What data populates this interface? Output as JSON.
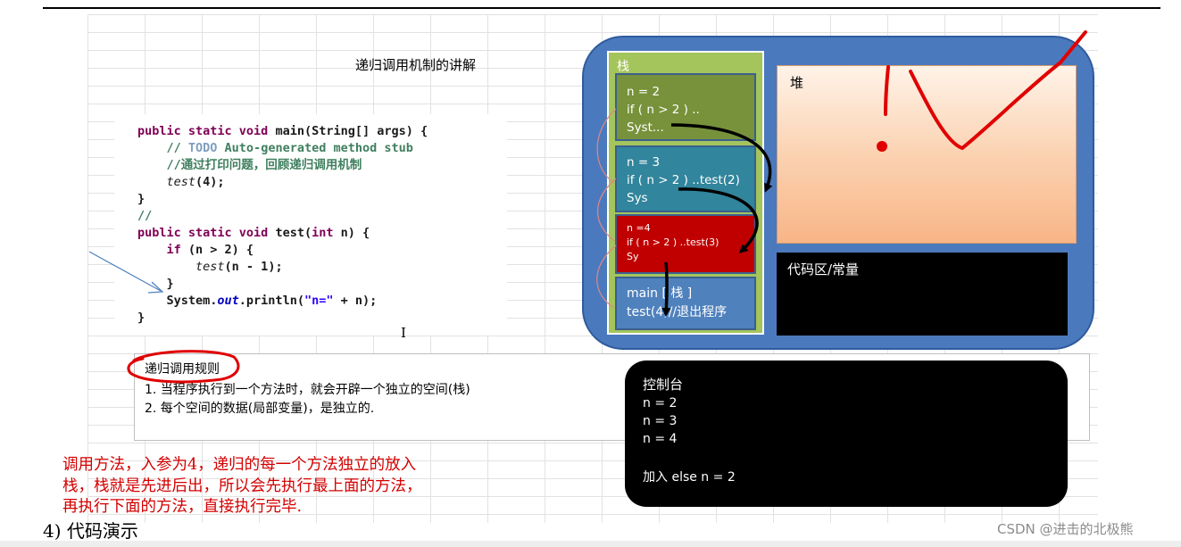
{
  "diagram_title": "递归调用机制的讲解",
  "code_lines": {
    "l1_kw": "public static void ",
    "l1_rest": "main(String[] args) {",
    "l2_indent": "    ",
    "l2_c1": "// ",
    "l2_todo": "TODO",
    "l2_c2": " Auto-generated method stub",
    "l3": "    //通过打印问题，回顾递归调用机制",
    "l4_indent": "    ",
    "l4_call": "test",
    "l4_rest": "(4);",
    "l5": "}",
    "l6": "//",
    "l7_kw": "public static void ",
    "l7_mid": "test(",
    "l7_kw2": "int",
    "l7_rest": " n) {",
    "l8_indent": "    ",
    "l8_kw": "if",
    "l8_rest": " (n > 2) {",
    "l9_indent": "        ",
    "l9_call": "test",
    "l9_rest": "(n - 1);",
    "l10": "    }",
    "l11_a": "    System.",
    "l11_field": "out",
    "l11_b": ".println(",
    "l11_str": "\"n=\"",
    "l11_c": " + n);",
    "l12": "}"
  },
  "text_cursor_glyph": "I",
  "memory": {
    "stack_label": "栈",
    "frames": [
      {
        "lines": [
          "n = 2",
          "if ( n > 2 ) ..",
          "Syst..."
        ]
      },
      {
        "lines": [
          "n = 3",
          "if ( n > 2 ) ..test(2)",
          "Sys"
        ]
      },
      {
        "lines": [
          "n =4",
          "if ( n > 2 ) ..test(3)",
          "Sy"
        ]
      },
      {
        "lines": [
          "main [ 栈 ]",
          "test(4)//退出程序"
        ]
      }
    ],
    "heap_label": "堆",
    "code_area_label": "代码区/常量"
  },
  "rules": {
    "title": "递归调用规则",
    "items": [
      "1. 当程序执行到一个方法时，就会开辟一个独立的空间(栈)",
      "2. 每个空间的数据(局部变量)，是独立的."
    ]
  },
  "console": {
    "title": "控制台",
    "lines": [
      "n = 2",
      "n = 3",
      "n = 4",
      "加入 else  n = 2"
    ]
  },
  "annotation_lines": [
    "调用方法，入参为4，递归的每一个方法独立的放入",
    "栈，栈就是先进后出，所以会先执行最上面的方法，",
    "再执行下面的方法，直接执行完毕."
  ],
  "section_heading": "4)   代码演示",
  "watermark": "CSDN @进击的北极熊",
  "colors": {
    "memory_bg": "#4b79bd",
    "stack_bg": "#a4c45c",
    "frame_top": "#77923a",
    "frame_2": "#31859c",
    "frame_3": "#c00000",
    "frame_main": "#4f81bd",
    "annotation": "#d40000"
  }
}
